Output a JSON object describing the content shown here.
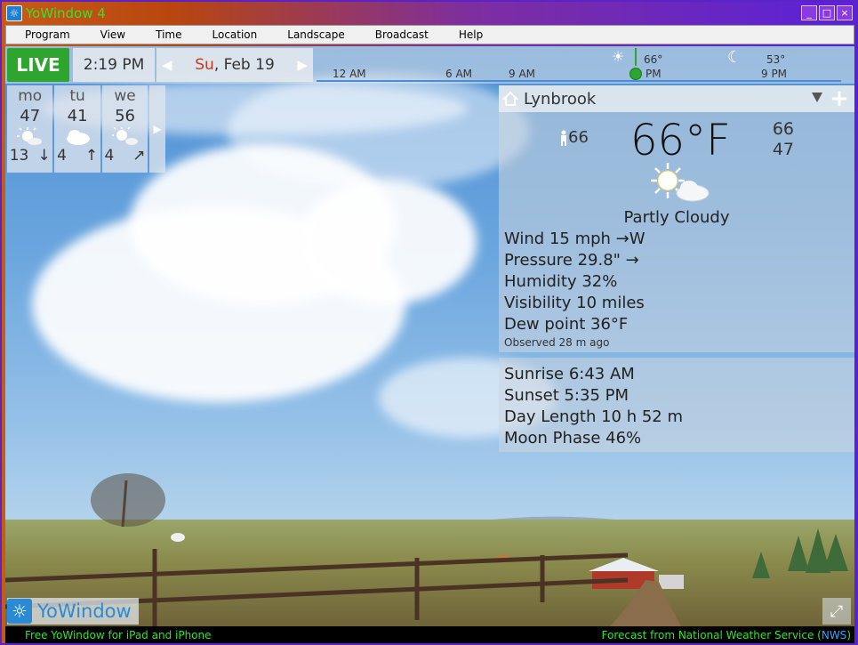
{
  "window": {
    "title": "YoWindow 4",
    "minimize_label": "_",
    "maximize_label": "□",
    "close_label": "×"
  },
  "menu": [
    "Program",
    "View",
    "Time",
    "Location",
    "Landscape",
    "Broadcast",
    "Help"
  ],
  "topbar": {
    "live_label": "LIVE",
    "time": "2:19 PM",
    "date_day": "Su",
    "date_rest": ", Feb 19",
    "timeline_labels": [
      "12 AM",
      "6 AM",
      "9 AM",
      "PM",
      "9 PM"
    ],
    "timeline_temp_day": "66°",
    "timeline_temp_night": "53°"
  },
  "forecast": [
    {
      "day": "mo",
      "temp": "47",
      "icon": "sunny-cloudy-icon",
      "wind": "13",
      "wind_dir": "↓"
    },
    {
      "day": "tu",
      "temp": "41",
      "icon": "cloudy-icon",
      "wind": "4",
      "wind_dir": "↑"
    },
    {
      "day": "we",
      "temp": "56",
      "icon": "partly-cloudy-icon",
      "wind": "4",
      "wind_dir": "↗"
    }
  ],
  "location": {
    "name": "Lynbrook",
    "add_label": "+"
  },
  "current": {
    "feels_like": "66",
    "temperature": "66°F",
    "high": "66",
    "low": "47",
    "condition": "Partly Cloudy",
    "wind": "Wind  15 mph →W",
    "pressure": "Pressure  29.8\" →",
    "humidity": "Humidity  32%",
    "visibility": "Visibility  10 miles",
    "dew_point": "Dew point  36°F",
    "observed": "Observed 28 m ago"
  },
  "astro": {
    "sunrise": "Sunrise  6:43 AM",
    "sunset": "Sunset  5:35 PM",
    "day_length": "Day Length  10 h 52 m",
    "moon_phase": "Moon Phase  46%"
  },
  "brand": {
    "name": "YoWindow"
  },
  "status": {
    "left": "Free YoWindow for iPad and iPhone",
    "right_prefix": "Forecast from National Weather Service (",
    "right_link": "NWS",
    "right_suffix": ")"
  },
  "colors": {
    "accent_green": "#2ea52e",
    "status_green": "#2ee62e",
    "brand_blue": "#2a8ad6",
    "date_red": "#c73a1f"
  }
}
